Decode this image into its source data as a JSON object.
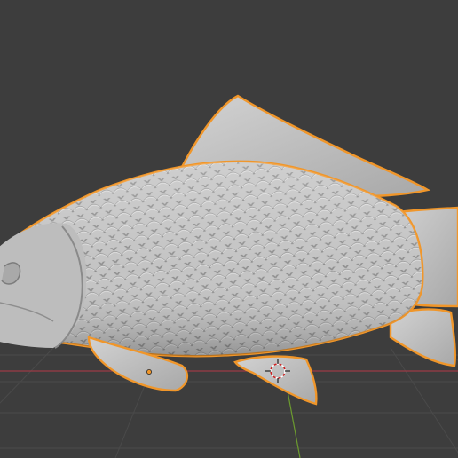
{
  "viewport": {
    "background": "#3d3d3d",
    "grid_color": "#4a4a4a",
    "x_axis_color": "#9b3b45",
    "y_axis_color": "#6c9b2f",
    "selection_outline_color": "#f0962a",
    "mesh_color": "#c9c9c9"
  },
  "object": {
    "icon": "fish-mesh-icon",
    "selected": true
  },
  "cursor_3d": {
    "icon": "crosshair-icon"
  },
  "origin": {
    "icon": "object-origin-icon"
  }
}
